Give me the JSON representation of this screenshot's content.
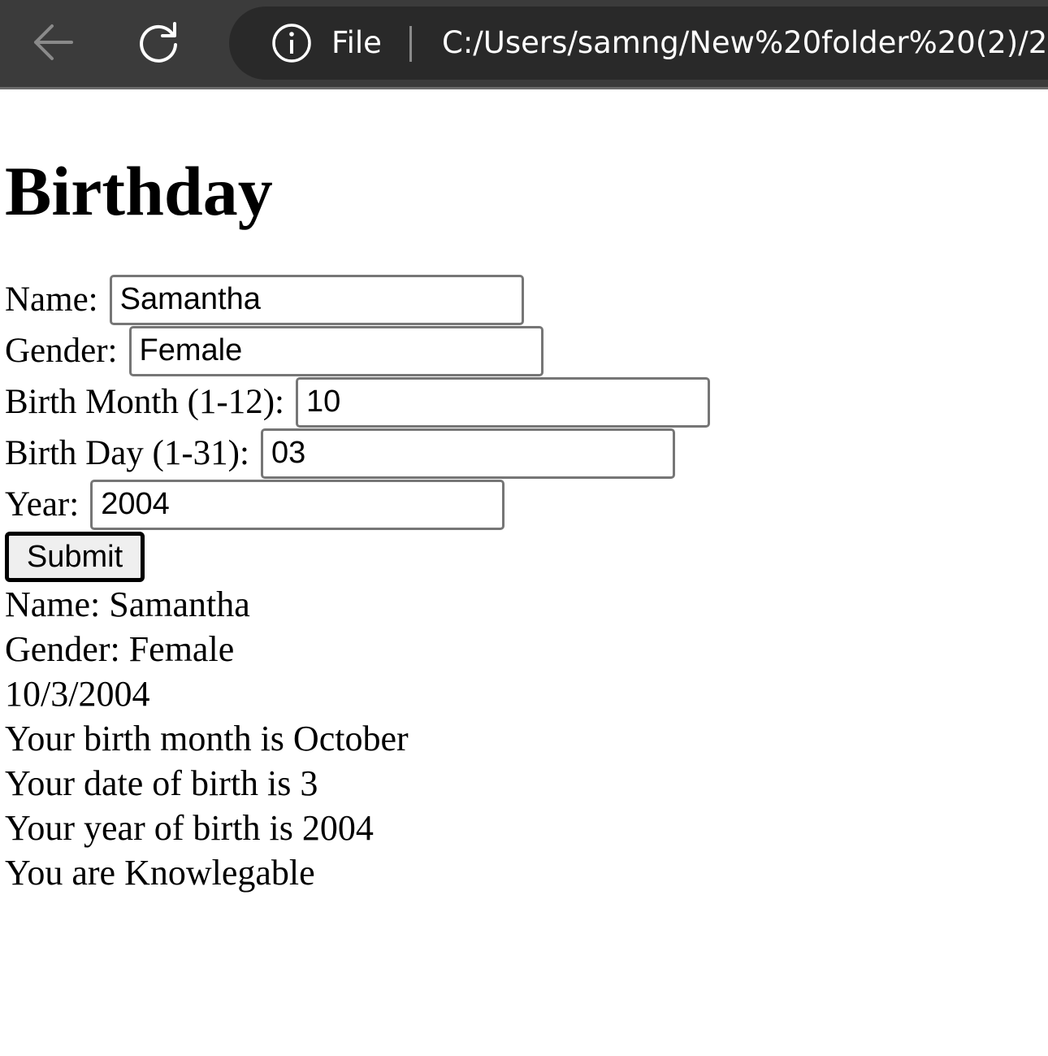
{
  "browser": {
    "file_label": "File",
    "url": "C:/Users/samng/New%20folder%20(2)/2"
  },
  "page": {
    "title": "Birthday"
  },
  "form": {
    "name_label": "Name:",
    "name_value": "Samantha",
    "gender_label": "Gender:",
    "gender_value": "Female",
    "month_label": "Birth Month (1-12):",
    "month_value": "10",
    "day_label": "Birth Day (1-31):",
    "day_value": "03",
    "year_label": "Year:",
    "year_value": "2004",
    "submit_label": "Submit"
  },
  "results": {
    "name_line": "Name: Samantha",
    "gender_line": "Gender: Female",
    "date_line": "10/3/2004",
    "month_line": "Your birth month is October",
    "day_line": "Your date of birth is 3",
    "year_line": "Your year of birth is 2004",
    "trait_line": "You are Knowlegable"
  }
}
